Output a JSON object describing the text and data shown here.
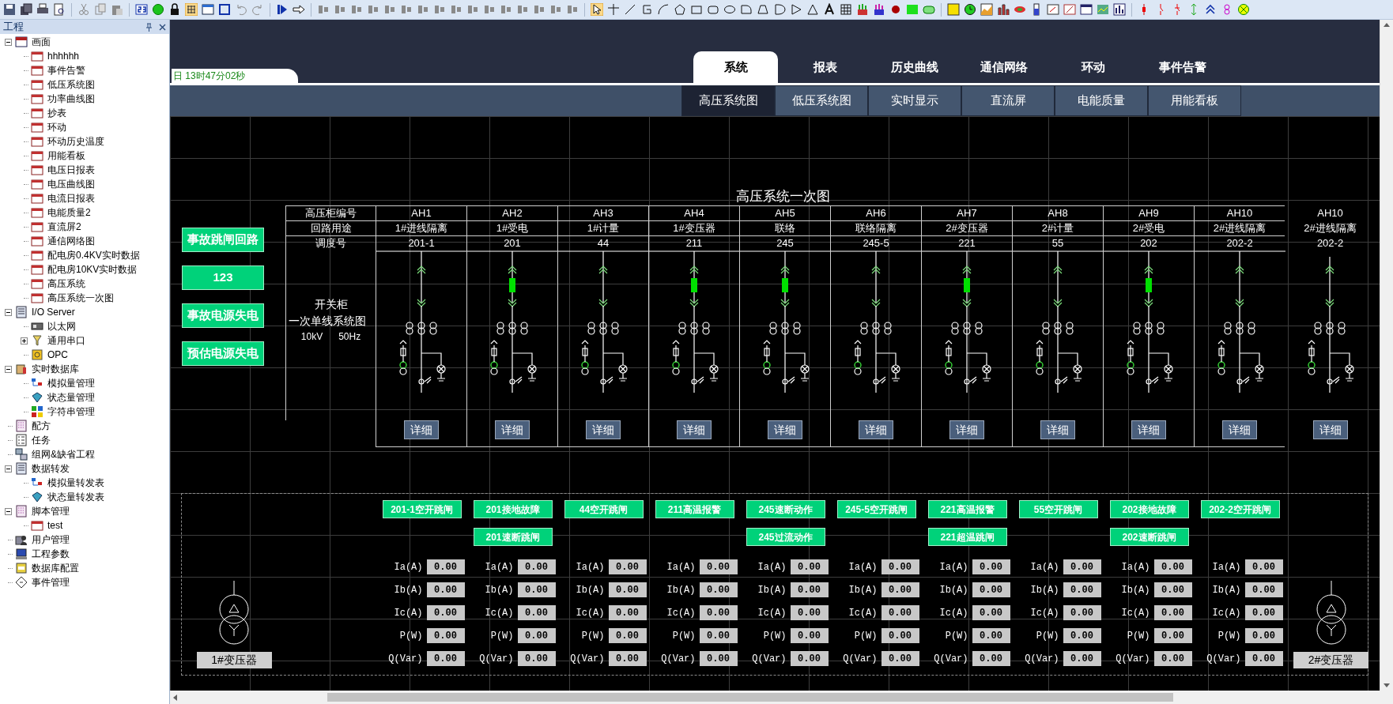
{
  "sidebar": {
    "title": "工程",
    "tree": [
      {
        "label": "画面",
        "kind": "window",
        "expanded": true,
        "children": [
          {
            "label": "hhhhhh",
            "kind": "screen"
          },
          {
            "label": "事件告警",
            "kind": "screen"
          },
          {
            "label": "低压系统图",
            "kind": "screen"
          },
          {
            "label": "功率曲线图",
            "kind": "screen"
          },
          {
            "label": "抄表",
            "kind": "screen"
          },
          {
            "label": "环动",
            "kind": "screen"
          },
          {
            "label": "环动历史温度",
            "kind": "screen"
          },
          {
            "label": "用能看板",
            "kind": "screen"
          },
          {
            "label": "电压日报表",
            "kind": "screen"
          },
          {
            "label": "电压曲线图",
            "kind": "screen"
          },
          {
            "label": "电流日报表",
            "kind": "screen"
          },
          {
            "label": "电能质量2",
            "kind": "screen"
          },
          {
            "label": "直流屏2",
            "kind": "screen"
          },
          {
            "label": "通信网络图",
            "kind": "screen"
          },
          {
            "label": "配电房0.4KV实时数据",
            "kind": "screen"
          },
          {
            "label": "配电房10KV实时数据",
            "kind": "screen"
          },
          {
            "label": "高压系统",
            "kind": "screen"
          },
          {
            "label": "高压系统一次图",
            "kind": "screen"
          }
        ]
      },
      {
        "label": "I/O Server",
        "kind": "server",
        "expanded": true,
        "children": [
          {
            "label": "以太网",
            "kind": "card"
          },
          {
            "label": "通用串口",
            "kind": "serial",
            "expanded": false
          },
          {
            "label": "OPC",
            "kind": "opc"
          }
        ]
      },
      {
        "label": "实时数据库",
        "kind": "database",
        "expanded": true,
        "children": [
          {
            "label": "模拟量管理",
            "kind": "analog"
          },
          {
            "label": "状态量管理",
            "kind": "status"
          },
          {
            "label": "字符串管理",
            "kind": "string"
          }
        ]
      },
      {
        "label": "配方",
        "kind": "recipe"
      },
      {
        "label": "任务",
        "kind": "task"
      },
      {
        "label": "组网&缺省工程",
        "kind": "network"
      },
      {
        "label": "数据转发",
        "kind": "server",
        "expanded": true,
        "children": [
          {
            "label": "模拟量转发表",
            "kind": "analog"
          },
          {
            "label": "状态量转发表",
            "kind": "status"
          }
        ]
      },
      {
        "label": "脚本管理",
        "kind": "recipe",
        "expanded": true,
        "children": [
          {
            "label": "test",
            "kind": "screen"
          }
        ]
      },
      {
        "label": "用户管理",
        "kind": "user"
      },
      {
        "label": "工程参数",
        "kind": "monitor"
      },
      {
        "label": "数据库配置",
        "kind": "sql"
      },
      {
        "label": "事件管理",
        "kind": "event"
      }
    ]
  },
  "header": {
    "clock": "日 13时47分02秒",
    "tabs": [
      {
        "label": "系统",
        "selected": true
      },
      {
        "label": "报表",
        "selected": false
      },
      {
        "label": "历史曲线",
        "selected": false
      },
      {
        "label": "通信网络",
        "selected": false
      },
      {
        "label": "环动",
        "selected": false
      },
      {
        "label": "事件告警",
        "selected": false
      }
    ],
    "subtabs": [
      {
        "label": "高压系统图",
        "selected": true
      },
      {
        "label": "低压系统图",
        "selected": false
      },
      {
        "label": "实时显示",
        "selected": false
      },
      {
        "label": "直流屏",
        "selected": false
      },
      {
        "label": "电能质量",
        "selected": false
      },
      {
        "label": "用能看板",
        "selected": false
      }
    ]
  },
  "diagram": {
    "title": "高压系统一次图",
    "side_buttons": [
      "事故跳闸回路",
      "123",
      "事故电源失电",
      "预估电源失电"
    ],
    "row_labels": [
      "高压柜编号",
      "回路用途",
      "调度号"
    ],
    "info_lines": [
      "开关柜",
      "一次单线系统图",
      "10kV",
      "50Hz"
    ],
    "cabinets": [
      {
        "id": "AH1",
        "use": "1#进线隔离",
        "code": "201-1",
        "breaker_closed": false,
        "detail": "详细"
      },
      {
        "id": "AH2",
        "use": "1#受电",
        "code": "201",
        "breaker_closed": true,
        "detail": "详细"
      },
      {
        "id": "AH3",
        "use": "1#计量",
        "code": "44",
        "breaker_closed": false,
        "detail": "详细"
      },
      {
        "id": "AH4",
        "use": "1#变压器",
        "code": "211",
        "breaker_closed": true,
        "detail": "详细"
      },
      {
        "id": "AH5",
        "use": "联络",
        "code": "245",
        "breaker_closed": true,
        "detail": "详细"
      },
      {
        "id": "AH6",
        "use": "联络隔离",
        "code": "245-5",
        "breaker_closed": false,
        "detail": "详细"
      },
      {
        "id": "AH7",
        "use": "2#变压器",
        "code": "221",
        "breaker_closed": true,
        "detail": "详细"
      },
      {
        "id": "AH8",
        "use": "2#计量",
        "code": "55",
        "breaker_closed": false,
        "detail": "详细"
      },
      {
        "id": "AH9",
        "use": "2#受电",
        "code": "202",
        "breaker_closed": true,
        "detail": "详细"
      },
      {
        "id": "AH10",
        "use": "2#进线隔离",
        "code": "202-2",
        "breaker_closed": false,
        "detail": "详细"
      },
      {
        "id": "AH10",
        "use": "2#进线隔离",
        "code": "202-2",
        "breaker_closed": false,
        "detail": "详细"
      }
    ],
    "transformers": [
      "1#变压器",
      "2#变压器"
    ],
    "groups": [
      {
        "alarms": [
          "201-1空开跳闸"
        ],
        "readings": [
          {
            "label": "Ia(A)",
            "value": "0.00"
          },
          {
            "label": "Ib(A)",
            "value": "0.00"
          },
          {
            "label": "Ic(A)",
            "value": "0.00"
          },
          {
            "label": "P(W)",
            "value": "0.00"
          },
          {
            "label": "Q(Var)",
            "value": "0.00"
          }
        ]
      },
      {
        "alarms": [
          "201接地故障",
          "201速断跳闸"
        ],
        "readings": [
          {
            "label": "Ia(A)",
            "value": "0.00"
          },
          {
            "label": "Ib(A)",
            "value": "0.00"
          },
          {
            "label": "Ic(A)",
            "value": "0.00"
          },
          {
            "label": "P(W)",
            "value": "0.00"
          },
          {
            "label": "Q(Var)",
            "value": "0.00"
          }
        ]
      },
      {
        "alarms": [
          "44空开跳闸"
        ],
        "readings": [
          {
            "label": "Ia(A)",
            "value": "0.00"
          },
          {
            "label": "Ib(A)",
            "value": "0.00"
          },
          {
            "label": "Ic(A)",
            "value": "0.00"
          },
          {
            "label": "P(W)",
            "value": "0.00"
          },
          {
            "label": "Q(Var)",
            "value": "0.00"
          }
        ]
      },
      {
        "alarms": [
          "211高温报警"
        ],
        "readings": [
          {
            "label": "Ia(A)",
            "value": "0.00"
          },
          {
            "label": "Ib(A)",
            "value": "0.00"
          },
          {
            "label": "Ic(A)",
            "value": "0.00"
          },
          {
            "label": "P(W)",
            "value": "0.00"
          },
          {
            "label": "Q(Var)",
            "value": "0.00"
          }
        ]
      },
      {
        "alarms": [
          "245速断动作",
          "245过流动作"
        ],
        "readings": [
          {
            "label": "Ia(A)",
            "value": "0.00"
          },
          {
            "label": "Ib(A)",
            "value": "0.00"
          },
          {
            "label": "Ic(A)",
            "value": "0.00"
          },
          {
            "label": "P(W)",
            "value": "0.00"
          },
          {
            "label": "Q(Var)",
            "value": "0.00"
          }
        ]
      },
      {
        "alarms": [
          "245-5空开跳闸"
        ],
        "readings": [
          {
            "label": "Ia(A)",
            "value": "0.00"
          },
          {
            "label": "Ib(A)",
            "value": "0.00"
          },
          {
            "label": "Ic(A)",
            "value": "0.00"
          },
          {
            "label": "P(W)",
            "value": "0.00"
          },
          {
            "label": "Q(Var)",
            "value": "0.00"
          }
        ]
      },
      {
        "alarms": [
          "221高温报警",
          "221超温跳闸"
        ],
        "readings": [
          {
            "label": "Ia(A)",
            "value": "0.00"
          },
          {
            "label": "Ib(A)",
            "value": "0.00"
          },
          {
            "label": "Ic(A)",
            "value": "0.00"
          },
          {
            "label": "P(W)",
            "value": "0.00"
          },
          {
            "label": "Q(Var)",
            "value": "0.00"
          }
        ]
      },
      {
        "alarms": [
          "55空开跳闸"
        ],
        "readings": [
          {
            "label": "Ia(A)",
            "value": "0.00"
          },
          {
            "label": "Ib(A)",
            "value": "0.00"
          },
          {
            "label": "Ic(A)",
            "value": "0.00"
          },
          {
            "label": "P(W)",
            "value": "0.00"
          },
          {
            "label": "Q(Var)",
            "value": "0.00"
          }
        ]
      },
      {
        "alarms": [
          "202接地故障",
          "202速断跳闸"
        ],
        "readings": [
          {
            "label": "Ia(A)",
            "value": "0.00"
          },
          {
            "label": "Ib(A)",
            "value": "0.00"
          },
          {
            "label": "Ic(A)",
            "value": "0.00"
          },
          {
            "label": "P(W)",
            "value": "0.00"
          },
          {
            "label": "Q(Var)",
            "value": "0.00"
          }
        ]
      },
      {
        "alarms": [
          "202-2空开跳闸"
        ],
        "readings": [
          {
            "label": "Ia(A)",
            "value": "0.00"
          },
          {
            "label": "Ib(A)",
            "value": "0.00"
          },
          {
            "label": "Ic(A)",
            "value": "0.00"
          },
          {
            "label": "P(W)",
            "value": "0.00"
          },
          {
            "label": "Q(Var)",
            "value": "0.00"
          }
        ]
      }
    ]
  }
}
